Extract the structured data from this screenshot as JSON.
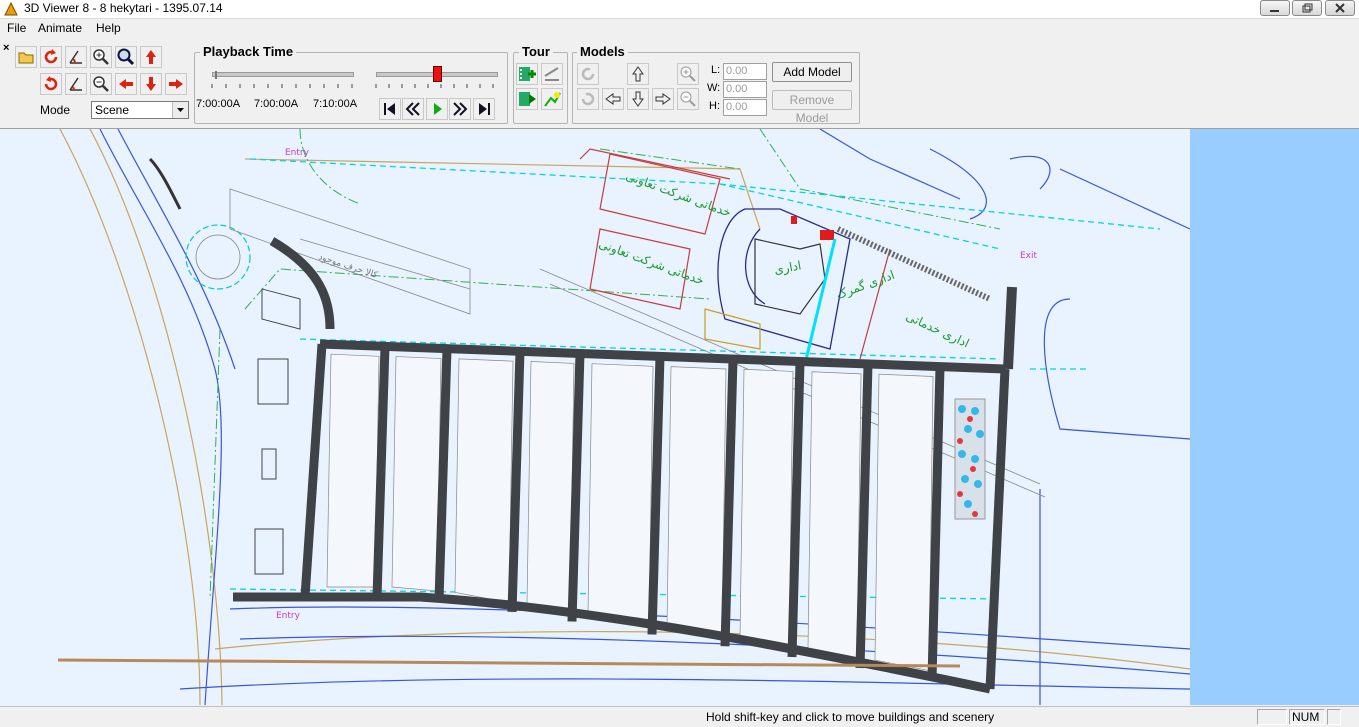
{
  "window": {
    "title": "3D Viewer 8 - 8 hekytari - 1395.07.14"
  },
  "menu": {
    "items": [
      "File",
      "Animate",
      "Help"
    ]
  },
  "toolbar": {
    "close_glyph": "×",
    "mode_label": "Mode",
    "mode_value": "Scene"
  },
  "playback": {
    "title": "Playback Time",
    "times": [
      "7:00:00A",
      "7:00:00A",
      "7:10:00A"
    ]
  },
  "tour": {
    "title": "Tour"
  },
  "models": {
    "title": "Models",
    "l_label": "L:",
    "l_value": "0.00",
    "w_label": "W:",
    "w_value": "0.00",
    "h_label": "H:",
    "h_value": "0.00",
    "add_label": "Add Model",
    "remove_label": "Remove Model"
  },
  "map": {
    "labels": {
      "entry_top": "Entry",
      "entry_bottom": "Entry",
      "exit": "Exit",
      "office": "اداری",
      "office_customs": "اداری گمرک",
      "office_services": "اداری خدماتی",
      "services_company": "خدماتی شرکت تعاونی",
      "services_company2": "خدماتی شرکت تعاونی",
      "warehouse": "کالا حرف موجود"
    }
  },
  "status": {
    "message": "Hold shift-key and click to move buildings and scenery",
    "num": "NUM"
  },
  "colors": {
    "sky": "#99ccff",
    "map_bg": "#e8f3ff",
    "road": "#3f4347",
    "cyan": "#00e6e6"
  }
}
